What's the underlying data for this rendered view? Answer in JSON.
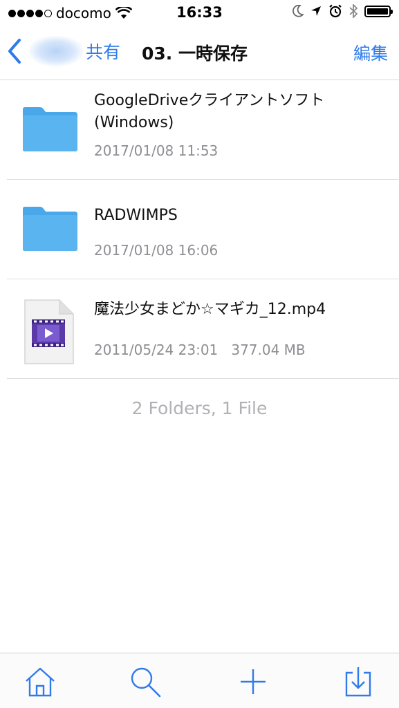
{
  "status_bar": {
    "carrier": "docomo",
    "time": "16:33"
  },
  "nav": {
    "back_label": "共有",
    "title": "03. 一時保存",
    "edit_label": "編集"
  },
  "files": [
    {
      "name": "GoogleDriveクライアントソフト (Windows)",
      "meta": "2017/01/08 11:53",
      "kind": "folder-icon"
    },
    {
      "name": "RADWIMPS",
      "meta": "2017/01/08 16:06",
      "kind": "folder-icon"
    },
    {
      "name": "魔法少女まどか☆マギカ_12.mp4",
      "meta": "2011/05/24 23:01   377.04 MB",
      "kind": "video-file-icon"
    }
  ],
  "summary": "2 Folders, 1 File",
  "tab_bar": {
    "items": [
      "home-icon",
      "search-icon",
      "add-icon",
      "download-icon"
    ]
  },
  "colors": {
    "accent": "#2f7bea",
    "folder": "#5ab4f0",
    "meta_text": "#8e8e93"
  }
}
